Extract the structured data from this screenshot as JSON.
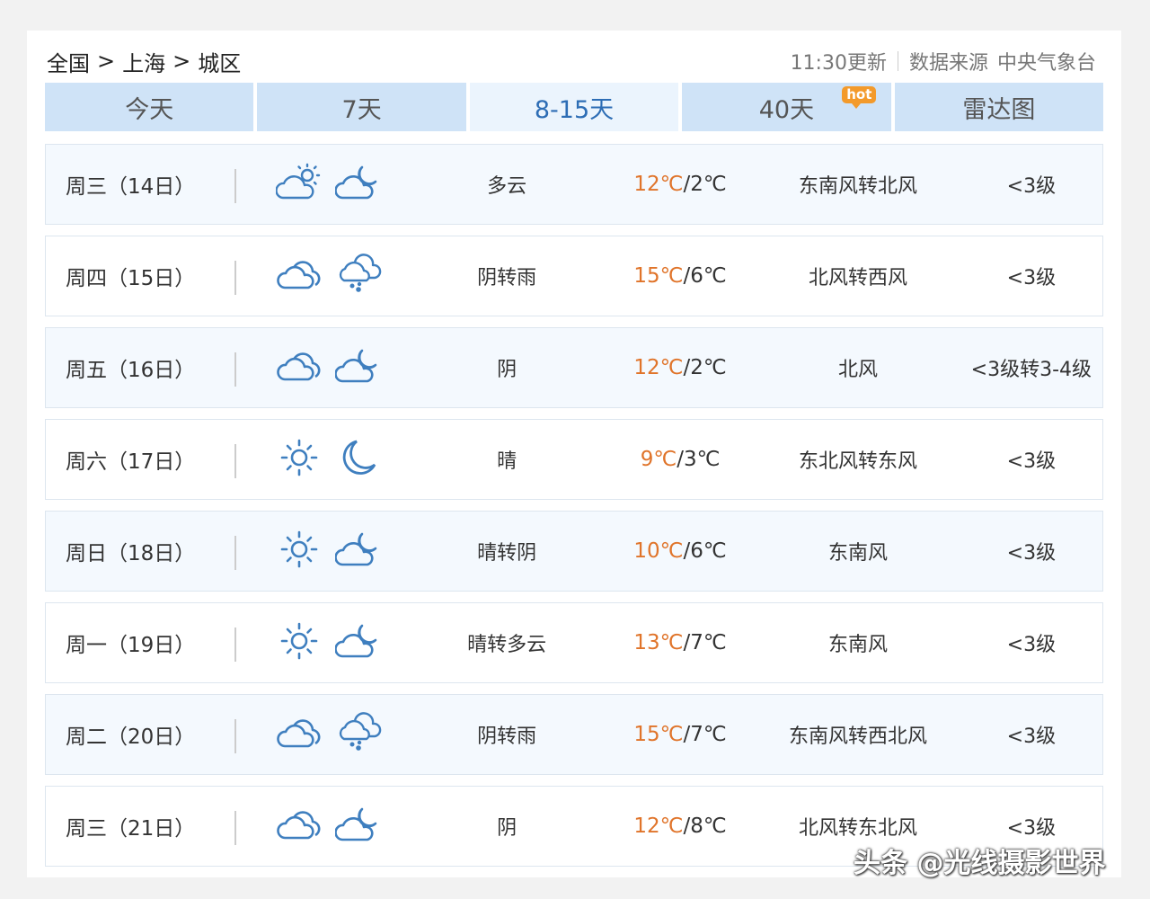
{
  "breadcrumb": [
    "全国",
    "上海",
    "城区"
  ],
  "breadcrumb_sep": ">",
  "meta": {
    "updated": "11:30更新",
    "source_label": "数据来源",
    "source": "中央气象台"
  },
  "tabs": [
    {
      "label": "今天"
    },
    {
      "label": "7天"
    },
    {
      "label": "8-15天",
      "active": true
    },
    {
      "label": "40天",
      "badge": "hot"
    },
    {
      "label": "雷达图"
    }
  ],
  "days": [
    {
      "day": "周三（14日）",
      "icons": [
        "partly-cloudy-sun-icon",
        "cloudy-moon-icon"
      ],
      "desc": "多云",
      "high": "12℃",
      "low": "/2℃",
      "wind": "东南风转北风",
      "level": "<3级"
    },
    {
      "day": "周四（15日）",
      "icons": [
        "overcast-icon",
        "rain-icon"
      ],
      "desc": "阴转雨",
      "high": "15℃",
      "low": "/6℃",
      "wind": "北风转西风",
      "level": "<3级"
    },
    {
      "day": "周五（16日）",
      "icons": [
        "overcast-icon",
        "cloudy-moon-icon"
      ],
      "desc": "阴",
      "high": "12℃",
      "low": "/2℃",
      "wind": "北风",
      "level": "<3级转3-4级"
    },
    {
      "day": "周六（17日）",
      "icons": [
        "sun-icon",
        "moon-icon"
      ],
      "desc": "晴",
      "high": "9℃",
      "low": "/3℃",
      "wind": "东北风转东风",
      "level": "<3级"
    },
    {
      "day": "周日（18日）",
      "icons": [
        "sun-icon",
        "cloudy-moon-icon"
      ],
      "desc": "晴转阴",
      "high": "10℃",
      "low": "/6℃",
      "wind": "东南风",
      "level": "<3级"
    },
    {
      "day": "周一（19日）",
      "icons": [
        "sun-icon",
        "cloudy-moon-icon"
      ],
      "desc": "晴转多云",
      "high": "13℃",
      "low": "/7℃",
      "wind": "东南风",
      "level": "<3级"
    },
    {
      "day": "周二（20日）",
      "icons": [
        "overcast-icon",
        "rain-icon"
      ],
      "desc": "阴转雨",
      "high": "15℃",
      "low": "/7℃",
      "wind": "东南风转西北风",
      "level": "<3级"
    },
    {
      "day": "周三（21日）",
      "icons": [
        "overcast-icon",
        "cloudy-moon-icon"
      ],
      "desc": "阴",
      "high": "12℃",
      "low": "/8℃",
      "wind": "北风转东北风",
      "level": "<3级"
    }
  ],
  "watermark": "头条 @光线摄影世界",
  "colors": {
    "tab_bg": "#cfe3f7",
    "tab_active_bg": "#ebf4fd",
    "tab_active_text": "#2d6db5",
    "high_temp": "#e0742a",
    "icon": "#3f7fbf",
    "hot_badge": "#f39a2b"
  }
}
